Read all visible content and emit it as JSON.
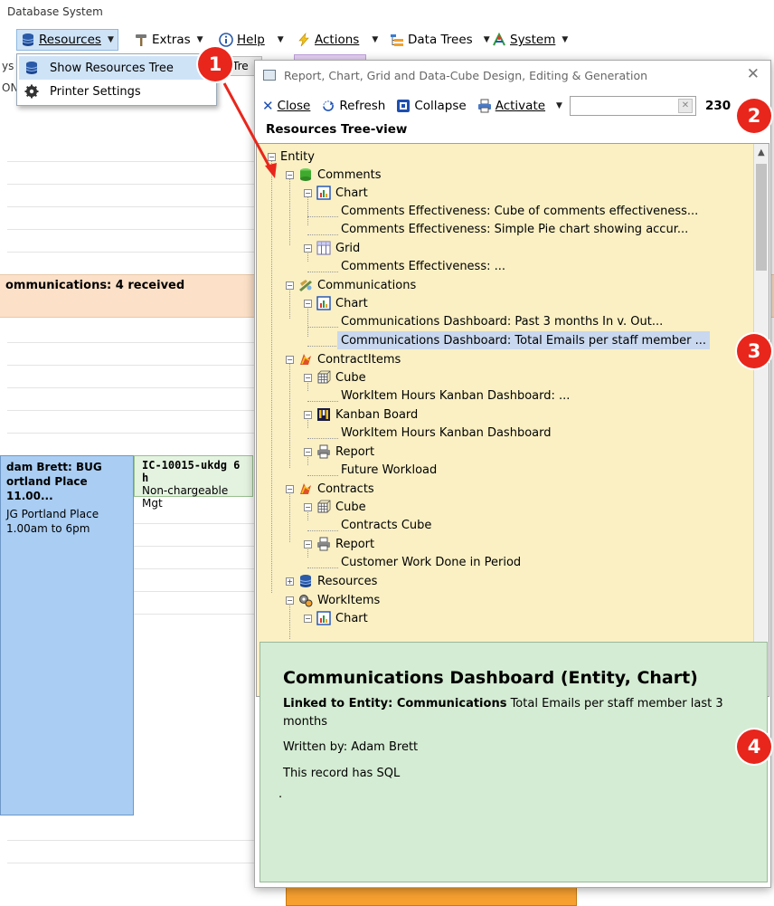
{
  "app": {
    "title": "Database System"
  },
  "menubar": {
    "items": [
      {
        "label": "Resources"
      },
      {
        "label": "Extras"
      },
      {
        "label": "Help"
      },
      {
        "label": "Actions"
      },
      {
        "label": "Data Trees"
      },
      {
        "label": "System"
      }
    ]
  },
  "resources_menu": {
    "items": [
      "Show Resources Tree",
      "Printer Settings"
    ]
  },
  "background": {
    "left_strip_top": "ys",
    "left_strip_mid": "ON",
    "tab_hint": "Tre",
    "communications_band": "ommunications: 4 received",
    "appt_adam_title": "dam Brett: BUG ortland Place 11.00...",
    "appt_adam_sub": "JG Portland Place 1.00am to 6pm",
    "appt_ic_title": "IC-10015-ukdg 6 h",
    "appt_ic_sub": "Non-chargeable Mgt"
  },
  "dialog": {
    "title": "Report, Chart, Grid and Data-Cube Design, Editing & Generation",
    "toolbar": {
      "close_label": "Close",
      "refresh_label": "Refresh",
      "collapse_label": "Collapse",
      "activate_label": "Activate",
      "search_value": "",
      "count": "230"
    },
    "tree_header": "Resources Tree-view",
    "tree": [
      {
        "label": "Entity",
        "icon": "none"
      },
      {
        "label": "Comments",
        "icon": "database-icon"
      },
      {
        "label": "Chart",
        "icon": "chart-icon"
      },
      {
        "label": "Comments Effectiveness: Cube of comments effectiveness...",
        "icon": "none"
      },
      {
        "label": "Comments Effectiveness: Simple Pie chart showing accur...",
        "icon": "none"
      },
      {
        "label": "Grid",
        "icon": "grid-icon"
      },
      {
        "label": "Comments Effectiveness: ...",
        "icon": "none"
      },
      {
        "label": "Communications",
        "icon": "communications-icon"
      },
      {
        "label": "Chart",
        "icon": "chart-icon"
      },
      {
        "label": "Communications Dashboard: Past 3 months In v. Out...",
        "icon": "none"
      },
      {
        "label": "Communications Dashboard: Total Emails per staff member ...",
        "icon": "none"
      },
      {
        "label": "ContractItems",
        "icon": "contract-icon"
      },
      {
        "label": "Cube",
        "icon": "cube-icon"
      },
      {
        "label": "WorkItem Hours Kanban Dashboard: ...",
        "icon": "none"
      },
      {
        "label": "Kanban Board",
        "icon": "kanban-icon"
      },
      {
        "label": "WorkItem Hours Kanban Dashboard",
        "icon": "none"
      },
      {
        "label": "Report",
        "icon": "report-icon"
      },
      {
        "label": "Future Workload",
        "icon": "none"
      },
      {
        "label": "Contracts",
        "icon": "contract-icon"
      },
      {
        "label": "Cube",
        "icon": "cube-icon"
      },
      {
        "label": "Contracts Cube",
        "icon": "none"
      },
      {
        "label": "Report",
        "icon": "report-icon"
      },
      {
        "label": "Customer Work Done in Period",
        "icon": "none"
      },
      {
        "label": "Resources",
        "icon": "database-icon"
      },
      {
        "label": "WorkItems",
        "icon": "workitems-icon"
      },
      {
        "label": "Chart",
        "icon": "chart-icon"
      }
    ],
    "detail": {
      "title": "Communications Dashboard (Entity, Chart)",
      "linked_prefix": "Linked to Entity: Communications",
      "linked_text": "Total Emails per staff member last 3 months",
      "written_by": "Written by: Adam Brett",
      "sql_note": "This record has SQL",
      "dot": "."
    }
  },
  "callouts": [
    "1",
    "2",
    "3",
    "4"
  ],
  "colors": {
    "tree_bg": "#faf0c4",
    "detail_bg": "#d4ecd3",
    "selection": "#c9d8ee",
    "callout": "#e8261c",
    "communications_band": "#fce0c8",
    "appointment_blue": "#a9cdf3"
  }
}
